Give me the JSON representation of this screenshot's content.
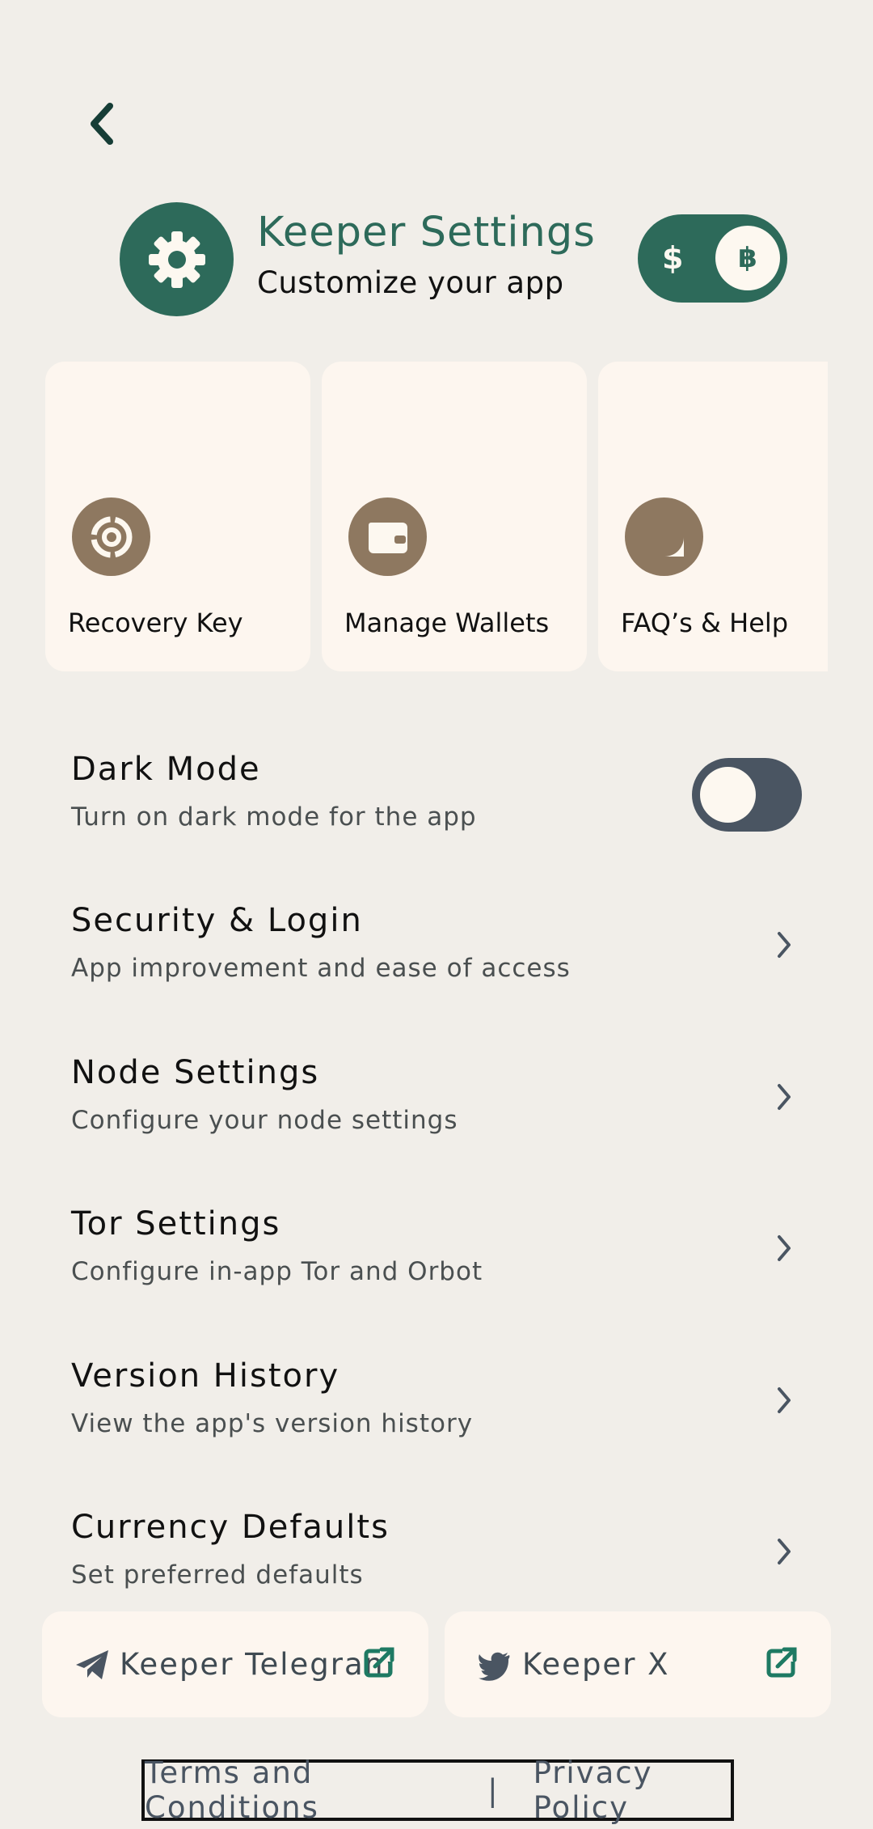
{
  "header": {
    "title": "Keeper Settings",
    "subtitle": "Customize your app",
    "icon": "gear-icon",
    "accent_color": "#2D6A5A"
  },
  "currency_toggle": {
    "left_symbol": "$",
    "right_symbol": "฿",
    "selected": "฿"
  },
  "quick_cards": [
    {
      "label": "Recovery Key",
      "icon": "recovery-key-icon"
    },
    {
      "label": "Manage Wallets",
      "icon": "wallet-icon"
    },
    {
      "label": "FAQ’s & Help",
      "icon": "help-icon"
    }
  ],
  "settings": [
    {
      "title": "Dark Mode",
      "description": "Turn on dark mode for the app",
      "control": "toggle",
      "enabled": false
    },
    {
      "title": "Security & Login",
      "description": "App improvement and ease of access",
      "control": "chevron"
    },
    {
      "title": "Node Settings",
      "description": "Configure your node settings",
      "control": "chevron"
    },
    {
      "title": "Tor Settings",
      "description": "Configure in-app Tor and Orbot",
      "control": "chevron"
    },
    {
      "title": "Version History",
      "description": "View the app's version history",
      "control": "chevron"
    },
    {
      "title": "Currency Defaults",
      "description": "Set preferred defaults",
      "control": "chevron"
    }
  ],
  "social_links": [
    {
      "label": "Keeper Telegram",
      "icon": "telegram-icon"
    },
    {
      "label": "Keeper X",
      "icon": "twitter-icon"
    }
  ],
  "footer": {
    "terms": "Terms and Conditions",
    "separator": "|",
    "privacy": "Privacy Policy"
  }
}
